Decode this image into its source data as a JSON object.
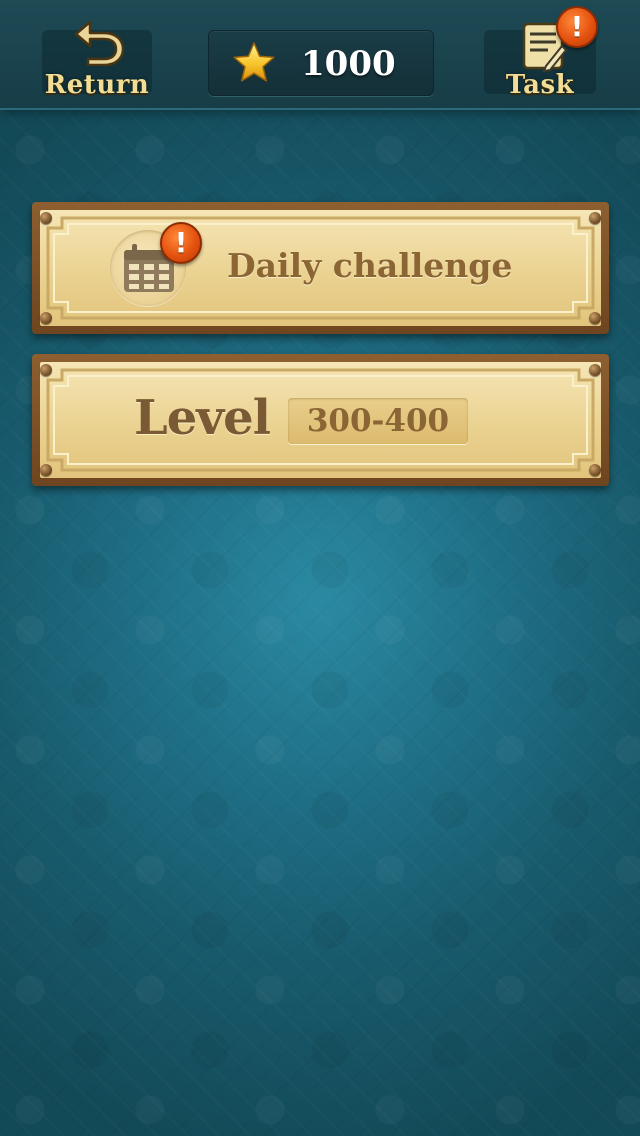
{
  "header": {
    "return_label": "Return",
    "task_label": "Task",
    "score": "1000",
    "alert_symbol": "!"
  },
  "menu": {
    "daily_challenge_label": "Daily challenge",
    "level_label": "Level",
    "level_range": "300-400"
  },
  "colors": {
    "background": "#1f6f86",
    "topbar": "#1a4450",
    "gold_text": "#f1dd95",
    "plaque_wood": "#7a5128",
    "plaque_parchment": "#f2ddaa",
    "plaque_text": "#8b6534",
    "alert_orange": "#e5520f",
    "star_yellow": "#f7c52a"
  },
  "icons": {
    "return": "return-arrow-icon",
    "star": "star-icon",
    "task": "task-notepad-icon",
    "calendar": "calendar-icon",
    "alert": "alert-exclamation-icon"
  }
}
